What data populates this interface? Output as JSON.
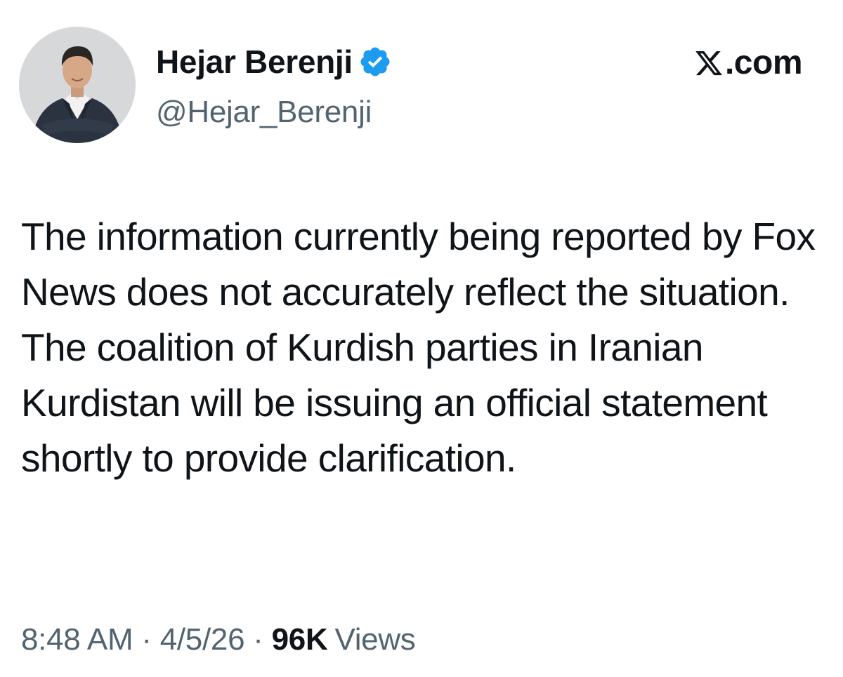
{
  "author": {
    "display_name": "Hejar Berenji",
    "handle": "@Hejar_Berenji",
    "verified": true,
    "avatar_icon": "profile-photo"
  },
  "brand": {
    "logo_icon": "x-logo-icon",
    "suffix": ".com"
  },
  "tweet": {
    "text": "The information currently being reported by Fox News does not accurately reflect the situation. The coalition of Kurdish parties in Iranian Kurdistan will be issuing an official statement shortly to provide clarification."
  },
  "meta": {
    "time": "8:48 AM",
    "separator": "·",
    "date": "4/5/26",
    "views_count": "96K",
    "views_label": "Views"
  },
  "colors": {
    "text_primary": "#0f1419",
    "text_secondary": "#536471",
    "verified_blue": "#1d9bf0"
  }
}
